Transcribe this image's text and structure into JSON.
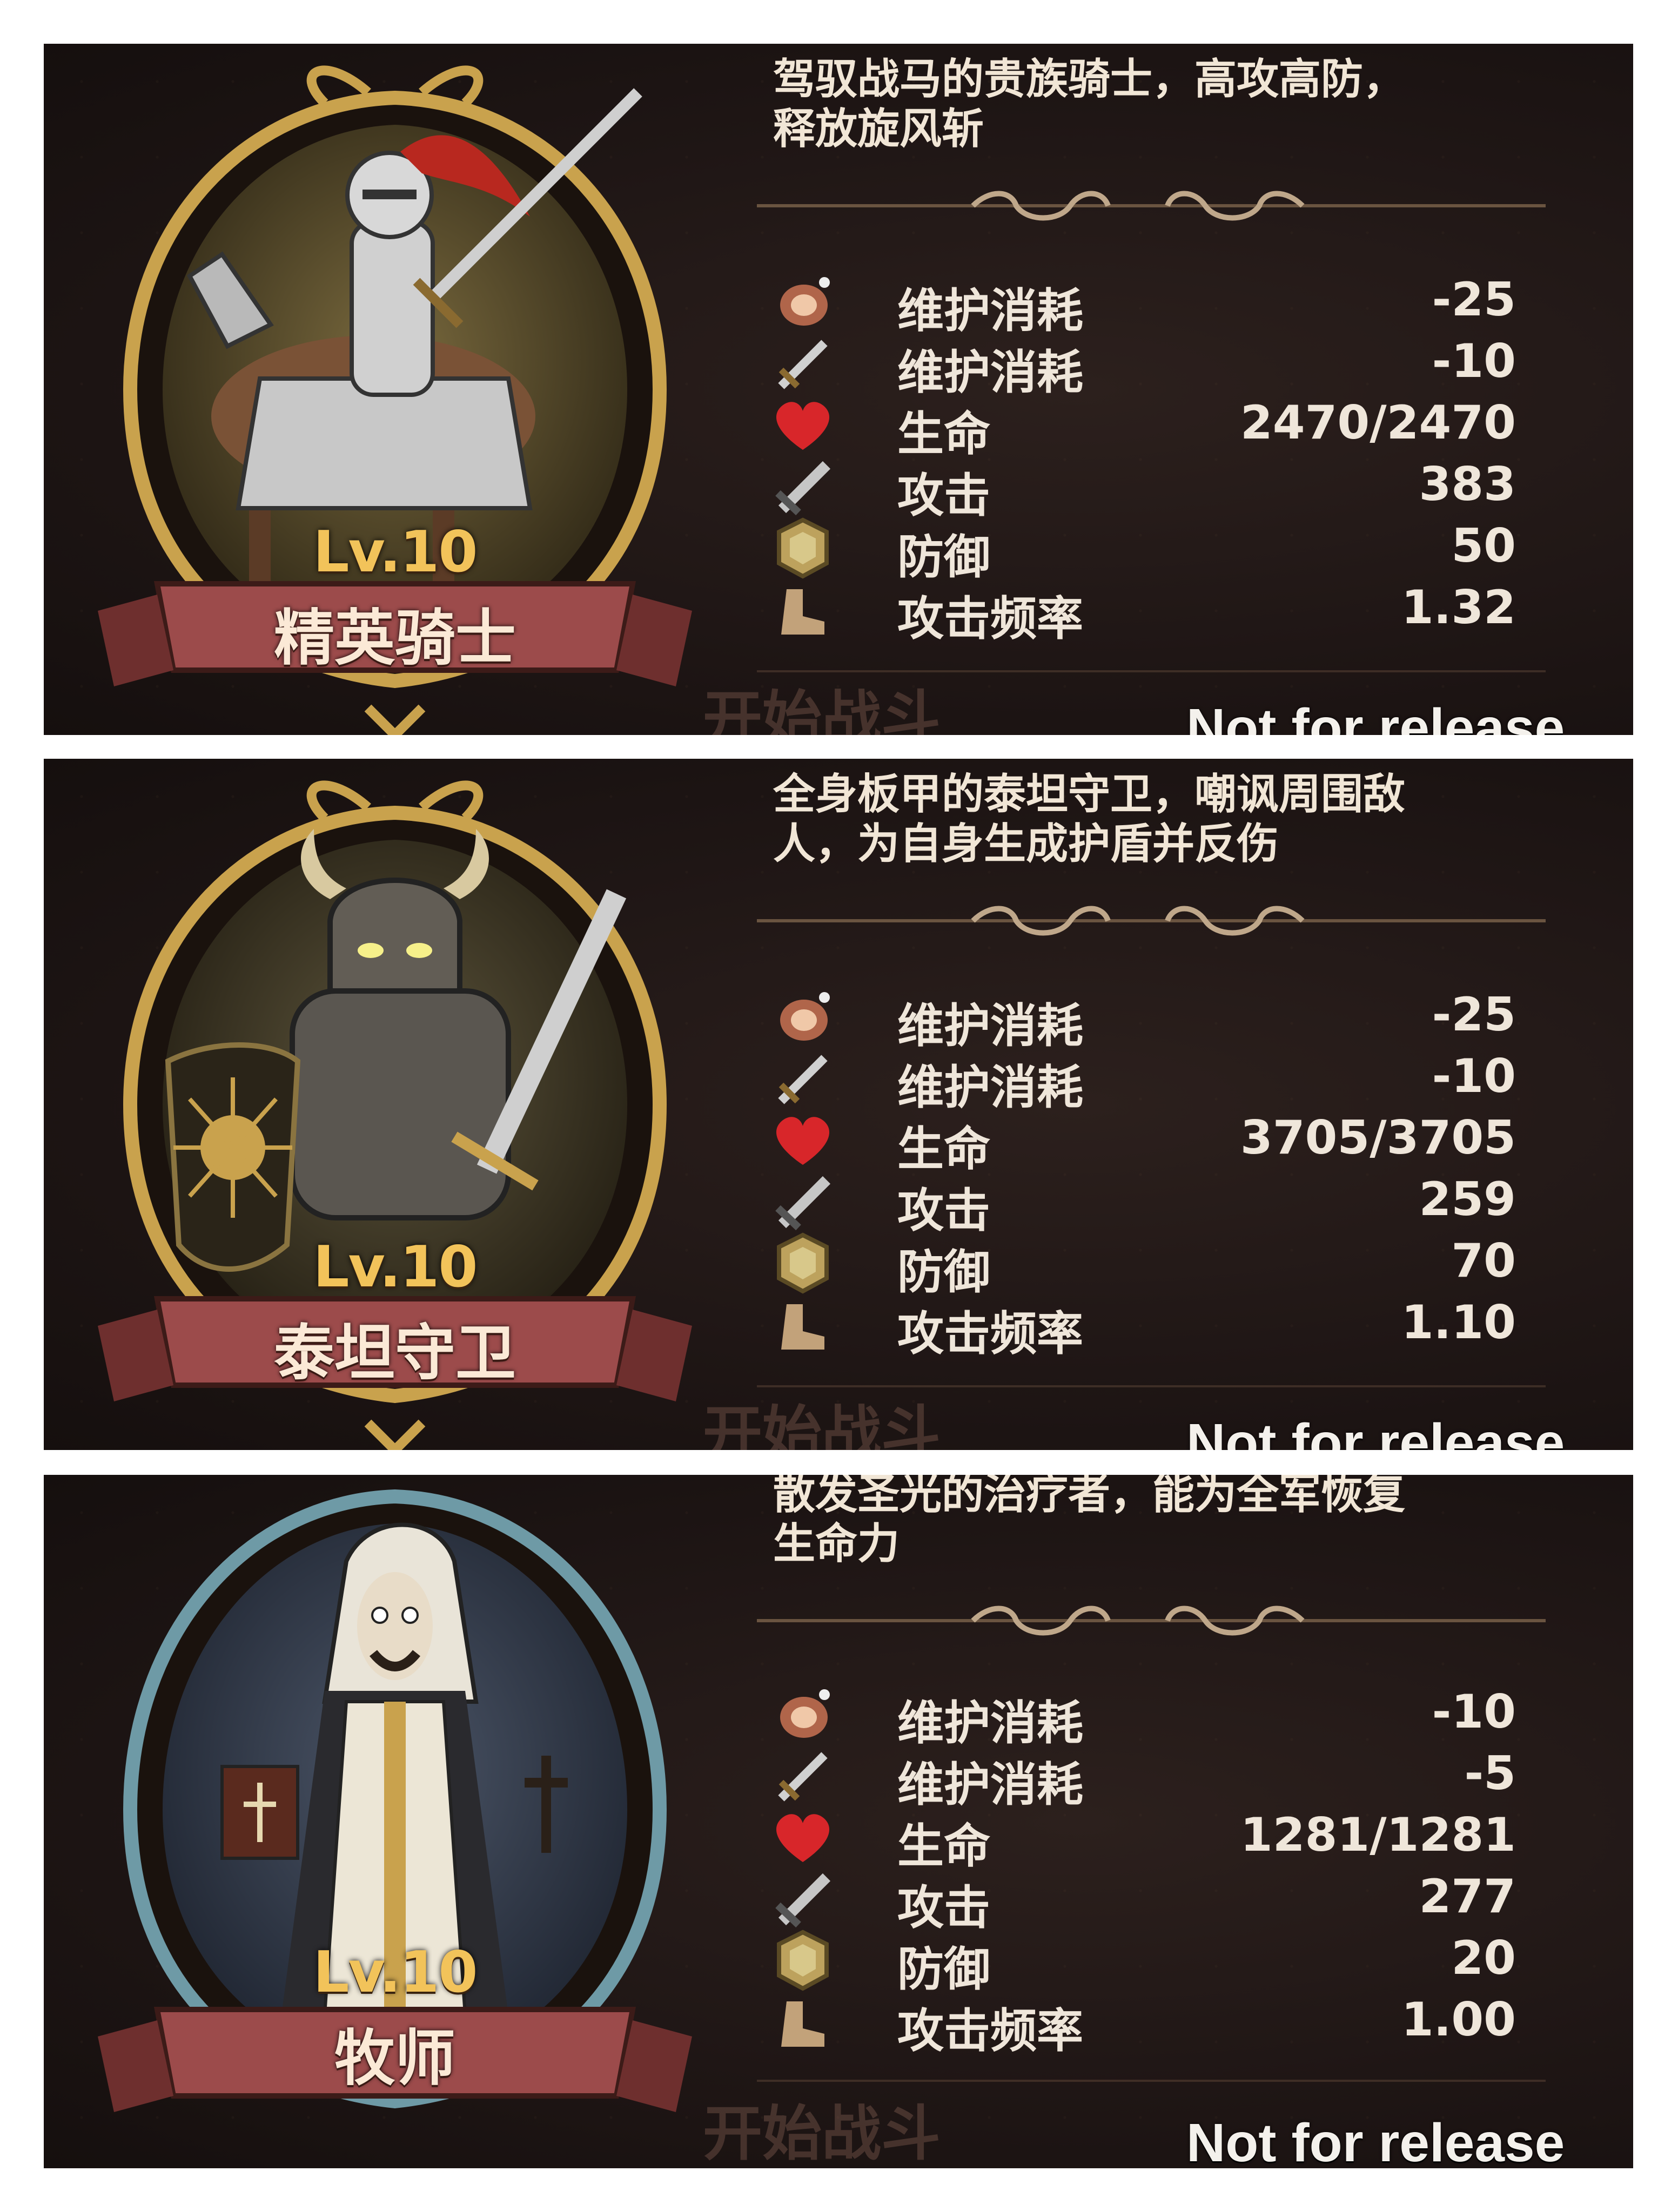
{
  "panels": [
    {
      "level": "Lv.10",
      "name": "精英骑士",
      "description_line1": "驾驭战马的贵族骑士，高攻高防，",
      "description_line2": "释放旋风斩",
      "frame_color": "#c9a24d",
      "portrait_icon": "knight-on-horse-icon",
      "stats": [
        {
          "icon": "meat-icon",
          "label": "维护消耗",
          "value": "-25"
        },
        {
          "icon": "dagger-icon",
          "label": "维护消耗",
          "value": "-10"
        },
        {
          "icon": "heart-icon",
          "label": "生命",
          "value": "2470/2470"
        },
        {
          "icon": "sword-icon",
          "label": "攻击",
          "value": "383"
        },
        {
          "icon": "shield-icon",
          "label": "防御",
          "value": "50"
        },
        {
          "icon": "boot-icon",
          "label": "攻击频率",
          "value": "1.32"
        }
      ],
      "start_button": "开始战斗",
      "watermark": "Not for release"
    },
    {
      "level": "Lv.10",
      "name": "泰坦守卫",
      "description_line1": "全身板甲的泰坦守卫，嘲讽周围敌",
      "description_line2": "人，为自身生成护盾并反伤",
      "frame_color": "#c9a24d",
      "portrait_icon": "horned-armored-guard-icon",
      "stats": [
        {
          "icon": "meat-icon",
          "label": "维护消耗",
          "value": "-25"
        },
        {
          "icon": "dagger-icon",
          "label": "维护消耗",
          "value": "-10"
        },
        {
          "icon": "heart-icon",
          "label": "生命",
          "value": "3705/3705"
        },
        {
          "icon": "sword-icon",
          "label": "攻击",
          "value": "259"
        },
        {
          "icon": "shield-icon",
          "label": "防御",
          "value": "70"
        },
        {
          "icon": "boot-icon",
          "label": "攻击频率",
          "value": "1.10"
        }
      ],
      "start_button": "开始战斗",
      "watermark": "Not for release"
    },
    {
      "level": "Lv.10",
      "name": "牧师",
      "description_line1": "散发圣光的治疗者，能为全军恢复",
      "description_line2": "生命力",
      "frame_color": "#6e9aa6",
      "portrait_icon": "hooded-priest-icon",
      "stats": [
        {
          "icon": "meat-icon",
          "label": "维护消耗",
          "value": "-10"
        },
        {
          "icon": "dagger-icon",
          "label": "维护消耗",
          "value": "-5"
        },
        {
          "icon": "heart-icon",
          "label": "生命",
          "value": "1281/1281"
        },
        {
          "icon": "sword-icon",
          "label": "攻击",
          "value": "277"
        },
        {
          "icon": "shield-icon",
          "label": "防御",
          "value": "20"
        },
        {
          "icon": "boot-icon",
          "label": "攻击频率",
          "value": "1.00"
        }
      ],
      "start_button": "开始战斗",
      "watermark": "Not for release"
    }
  ]
}
